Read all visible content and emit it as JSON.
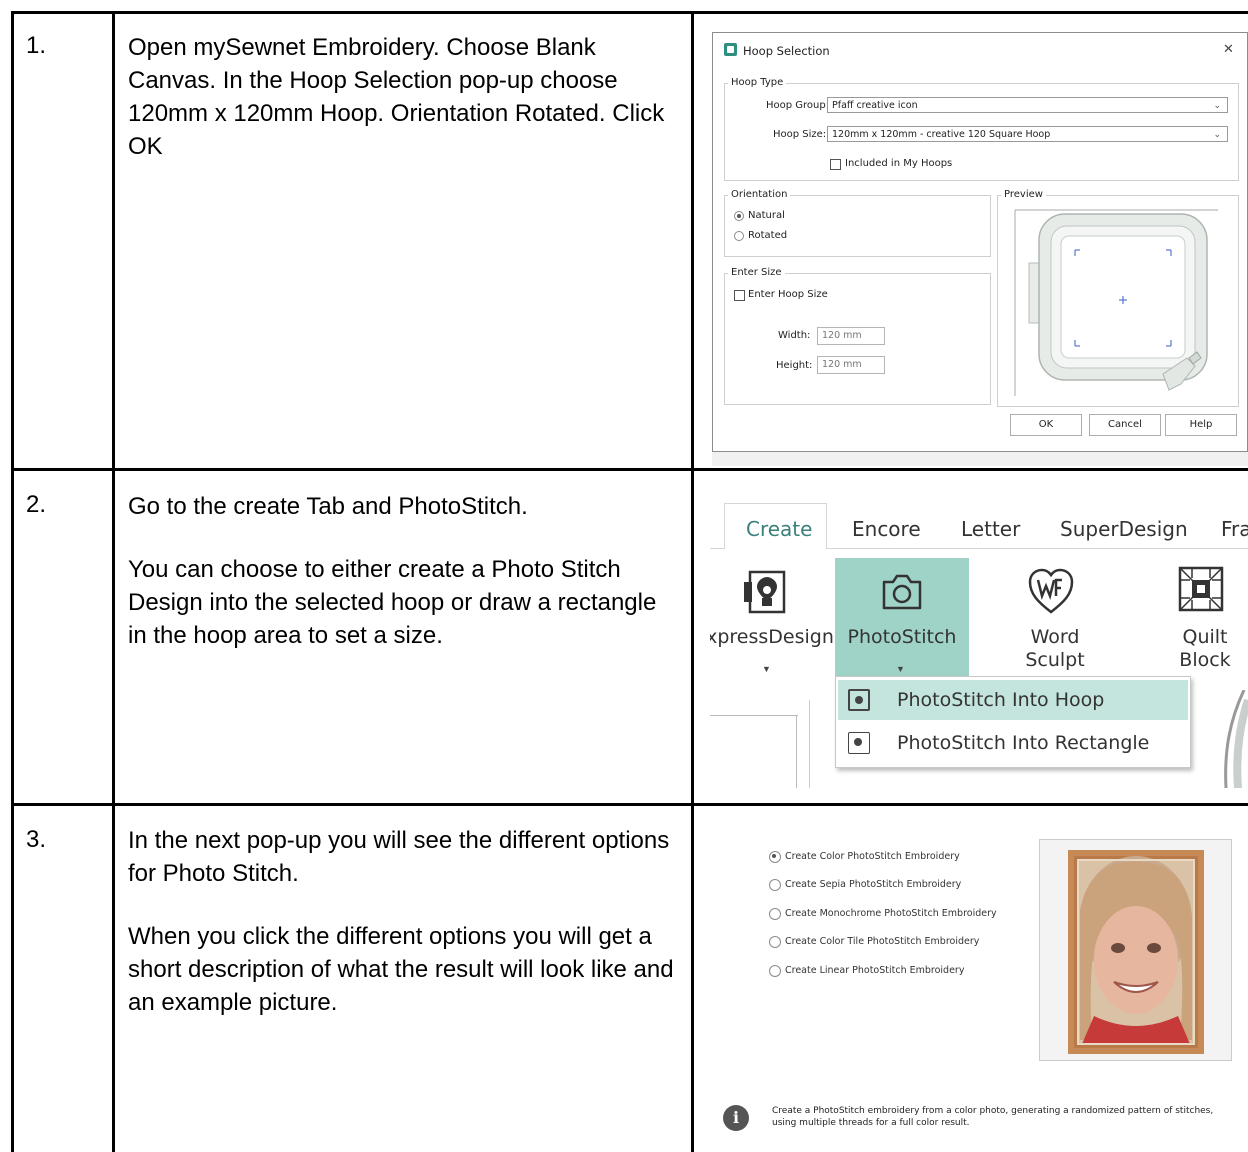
{
  "rows": [
    {
      "number": "1.",
      "paragraphs": [
        "Open mySewnet Embroidery. Choose Blank Canvas. In the Hoop Selection pop-up choose 120mm x 120mm Hoop. Orientation Rotated. Click OK"
      ]
    },
    {
      "number": "2.",
      "paragraphs": [
        "Go to  the create Tab and PhotoStitch.",
        "You can choose to either create a Photo Stitch Design into the selected hoop or draw a rectangle in the hoop area to set a size."
      ]
    },
    {
      "number": "3.",
      "paragraphs": [
        "In the next pop-up you will see the different options for Photo Stitch.",
        "When you click the different options you will get a short description of what the result will look like and an example picture."
      ]
    }
  ],
  "hoop_dialog": {
    "title": "Hoop Selection",
    "close_glyph": "✕",
    "hoop_type_legend": "Hoop Type",
    "hoop_group_label": "Hoop Group:",
    "hoop_group_value": "Pfaff creative icon",
    "hoop_size_label": "Hoop Size:",
    "hoop_size_value": "120mm x 120mm - creative 120 Square Hoop",
    "included_label": "Included in My Hoops",
    "orientation_legend": "Orientation",
    "natural_label": "Natural",
    "rotated_label": "Rotated",
    "orientation_selected": "Natural",
    "preview_legend": "Preview",
    "enter_size_legend": "Enter Size",
    "enter_hoop_size_label": "Enter Hoop Size",
    "width_label": "Width:",
    "width_value": "120 mm",
    "height_label": "Height:",
    "height_value": "120 mm",
    "ok_label": "OK",
    "cancel_label": "Cancel",
    "help_label": "Help"
  },
  "ribbon": {
    "tabs": [
      "Create",
      "Encore",
      "Letter",
      "SuperDesign",
      "Fra"
    ],
    "active_tab": "Create",
    "tools": {
      "express_design": "xpressDesign",
      "photostitch": "PhotoStitch",
      "word_sculpt_line1": "Word",
      "word_sculpt_line2": "Sculpt",
      "quilt_block_line1": "Quilt",
      "quilt_block_line2": "Block"
    },
    "menu": [
      "PhotoStitch Into Hoop",
      "PhotoStitch Into Rectangle"
    ],
    "accent": "#9fd3c7"
  },
  "photostitch_options": {
    "options": [
      "Create Color PhotoStitch Embroidery",
      "Create Sepia PhotoStitch Embroidery",
      "Create Monochrome PhotoStitch Embroidery",
      "Create Color Tile PhotoStitch Embroidery",
      "Create Linear PhotoStitch Embroidery"
    ],
    "selected_index": 0,
    "description_line1": "Create a PhotoStitch embroidery from a color photo, generating a randomized pattern of stitches,",
    "description_line2": "using multiple threads for a full color result."
  }
}
